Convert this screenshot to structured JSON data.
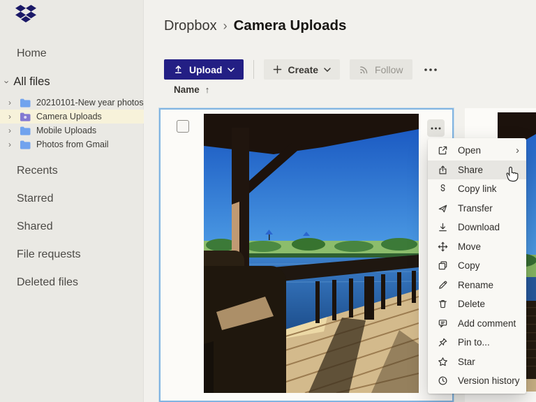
{
  "icons": {
    "chevron_right": "›",
    "chevron_down": "›"
  },
  "sidebar": {
    "home_label": "Home",
    "all_files_label": "All files",
    "folders": [
      {
        "label": "20210101-New year photos",
        "selected": false
      },
      {
        "label": "Camera Uploads",
        "selected": true
      },
      {
        "label": "Mobile Uploads",
        "selected": false
      },
      {
        "label": "Photos from Gmail",
        "selected": false
      }
    ],
    "items": [
      {
        "label": "Recents"
      },
      {
        "label": "Starred"
      },
      {
        "label": "Shared"
      },
      {
        "label": "File requests"
      },
      {
        "label": "Deleted files"
      }
    ]
  },
  "header": {
    "breadcrumb_root": "Dropbox",
    "breadcrumb_separator": "›",
    "breadcrumb_current": "Camera Uploads"
  },
  "toolbar": {
    "upload_label": "Upload",
    "create_label": "Create",
    "follow_label": "Follow"
  },
  "list_header": {
    "name_label": "Name",
    "sort_arrow": "↑"
  },
  "file_tile": {
    "selected": true,
    "checkbox_checked": false,
    "type": "photo-thumbnail"
  },
  "context_menu": {
    "items": [
      {
        "label": "Open",
        "icon": "open-icon",
        "has_submenu": true,
        "hovered": false
      },
      {
        "label": "Share",
        "icon": "share-icon",
        "has_submenu": false,
        "hovered": true
      },
      {
        "label": "Copy link",
        "icon": "copy-link-icon"
      },
      {
        "label": "Transfer",
        "icon": "transfer-icon"
      },
      {
        "label": "Download",
        "icon": "download-icon"
      },
      {
        "label": "Move",
        "icon": "move-icon"
      },
      {
        "label": "Copy",
        "icon": "copy-icon"
      },
      {
        "label": "Rename",
        "icon": "rename-icon"
      },
      {
        "label": "Delete",
        "icon": "delete-icon"
      },
      {
        "label": "Add comment",
        "icon": "add-comment-icon"
      },
      {
        "label": "Pin to...",
        "icon": "pin-icon"
      },
      {
        "label": "Star",
        "icon": "star-icon"
      },
      {
        "label": "Version history",
        "icon": "version-history-icon"
      }
    ]
  },
  "colors": {
    "upload_button": "#231f84",
    "selection_border": "#82b5e2",
    "sidebar_highlight": "#f7f2da",
    "menu_hover": "#e7e6e2",
    "folder_icon": "#71a3ee",
    "camera_folder_icon": "#8379d2",
    "logo": "#1b1967"
  }
}
